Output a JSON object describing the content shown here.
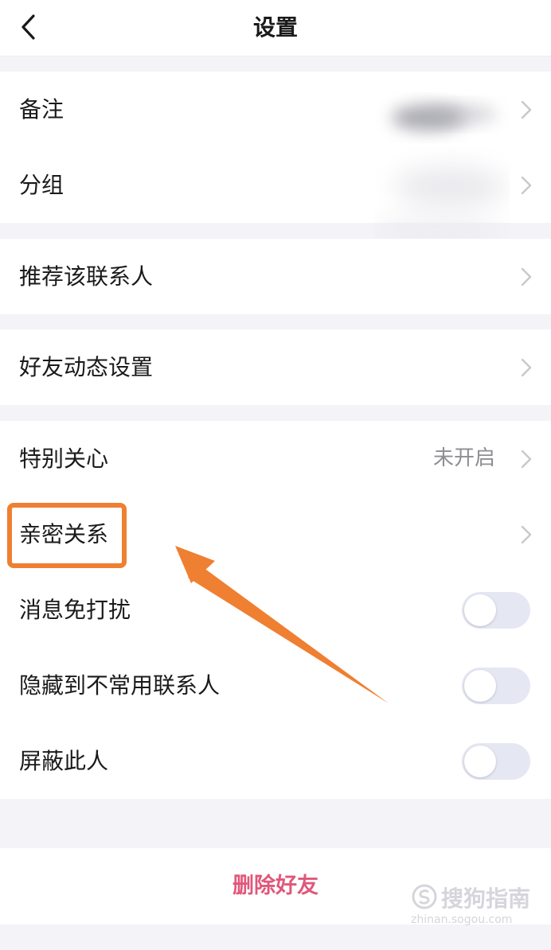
{
  "header": {
    "title": "设置",
    "back_icon": "chevron-left-icon"
  },
  "groups": [
    {
      "items": [
        {
          "label": "备注"
        },
        {
          "label": "分组"
        }
      ]
    },
    {
      "items": [
        {
          "label": "推荐该联系人"
        }
      ]
    },
    {
      "items": [
        {
          "label": "好友动态设置"
        }
      ]
    },
    {
      "items": [
        {
          "label": "特别关心",
          "value": "未开启"
        },
        {
          "label": "亲密关系"
        },
        {
          "label": "消息免打扰",
          "toggle_on": false
        },
        {
          "label": "隐藏到不常用联系人",
          "toggle_on": false
        },
        {
          "label": "屏蔽此人",
          "toggle_on": false
        }
      ]
    }
  ],
  "delete_button": {
    "label": "删除好友"
  },
  "watermark": {
    "name": "搜狗指南",
    "url": "zhinan.sogou.com"
  },
  "colors": {
    "highlight": "#ef7f31",
    "delete_text": "#e0577a",
    "toggle_off": "#e5e7f3",
    "background": "#f3f3f8"
  }
}
